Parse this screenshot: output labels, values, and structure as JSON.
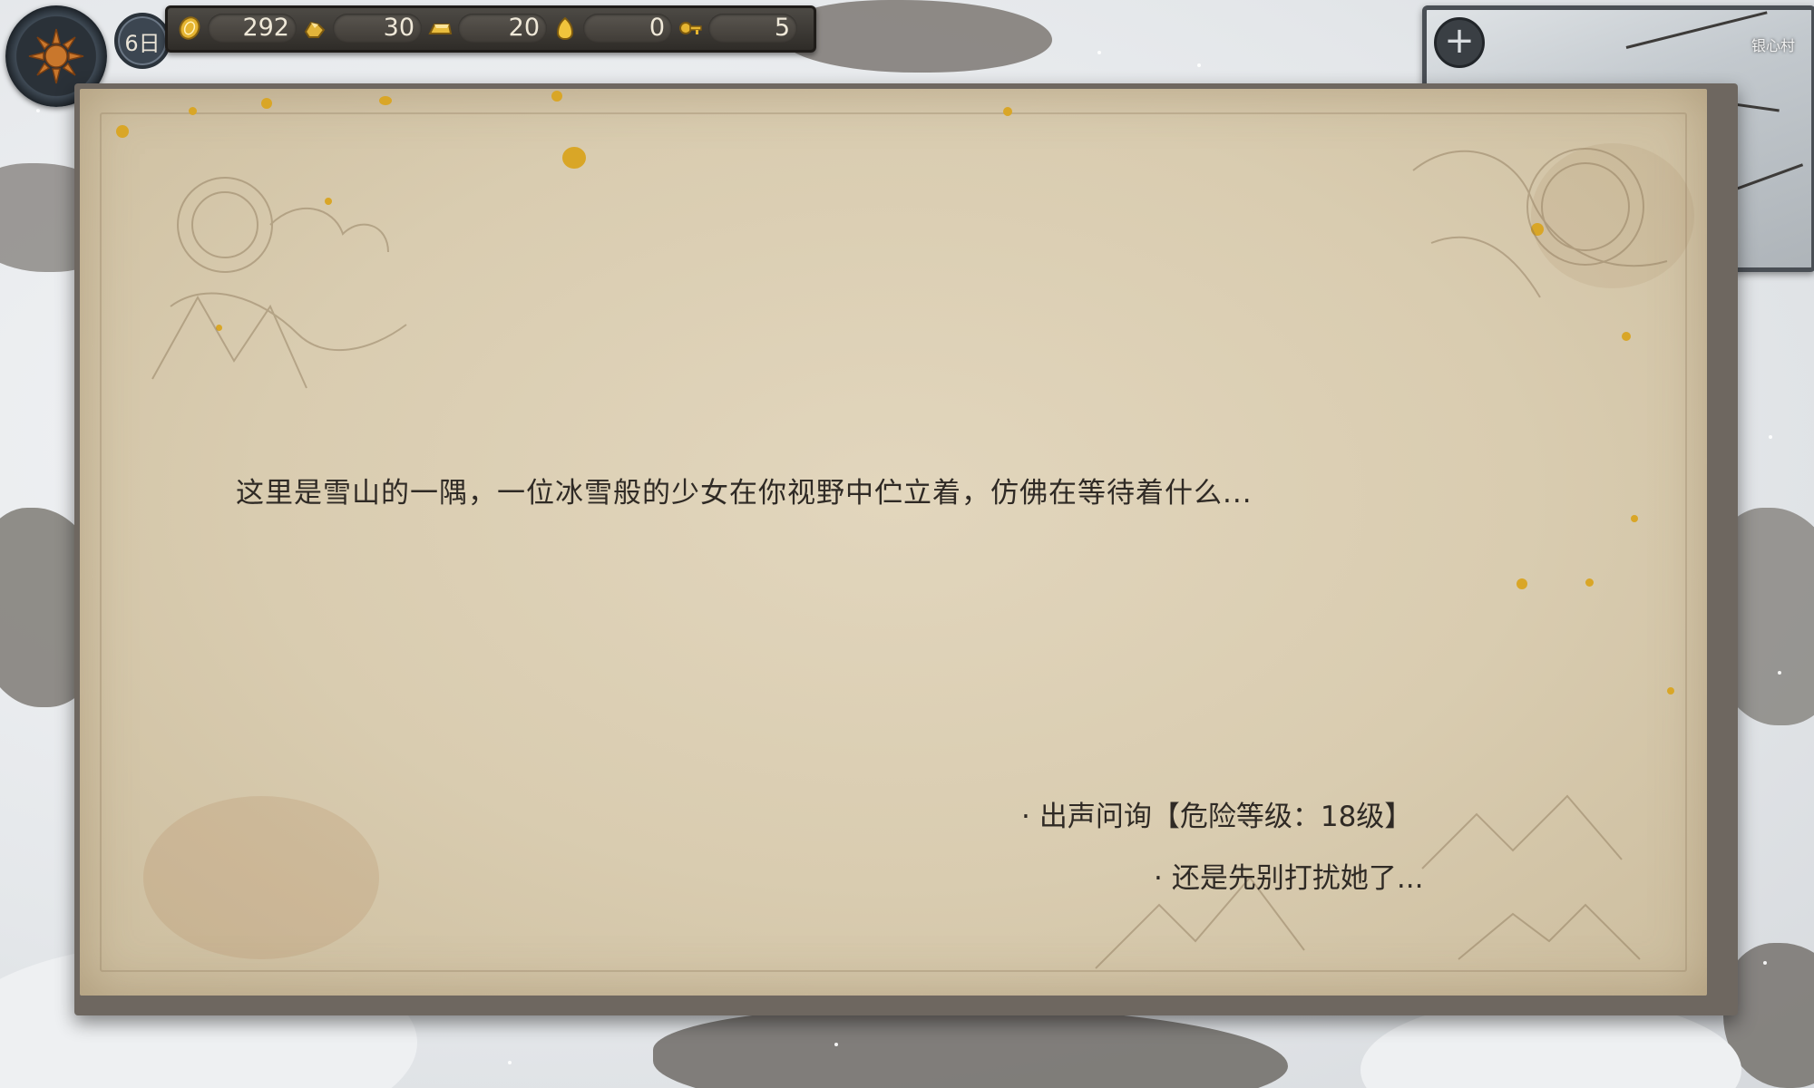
{
  "hud": {
    "day_label": "6日",
    "resources": [
      {
        "icon": "gold-coin-icon",
        "value": "292"
      },
      {
        "icon": "ore-icon",
        "value": "30"
      },
      {
        "icon": "gold-bar-icon",
        "value": "20"
      },
      {
        "icon": "gold-ingot-icon",
        "value": "0"
      },
      {
        "icon": "key-icon",
        "value": "5"
      }
    ]
  },
  "minimap": {
    "zoom_icon": "+",
    "location_label": "银心村"
  },
  "event": {
    "description": "这里是雪山的一隅，一位冰雪般的少女在你视野中伫立着，仿佛在等待着什么...",
    "options": [
      {
        "bullet": "·",
        "label": "出声问询【危险等级：18级】"
      },
      {
        "bullet": "·",
        "label": "还是先别打扰她了..."
      }
    ]
  },
  "colors": {
    "parchment": "#d9ccb0",
    "frame": "#6e6760",
    "text": "#2f2a25",
    "gold_accent": "#d9a627"
  }
}
